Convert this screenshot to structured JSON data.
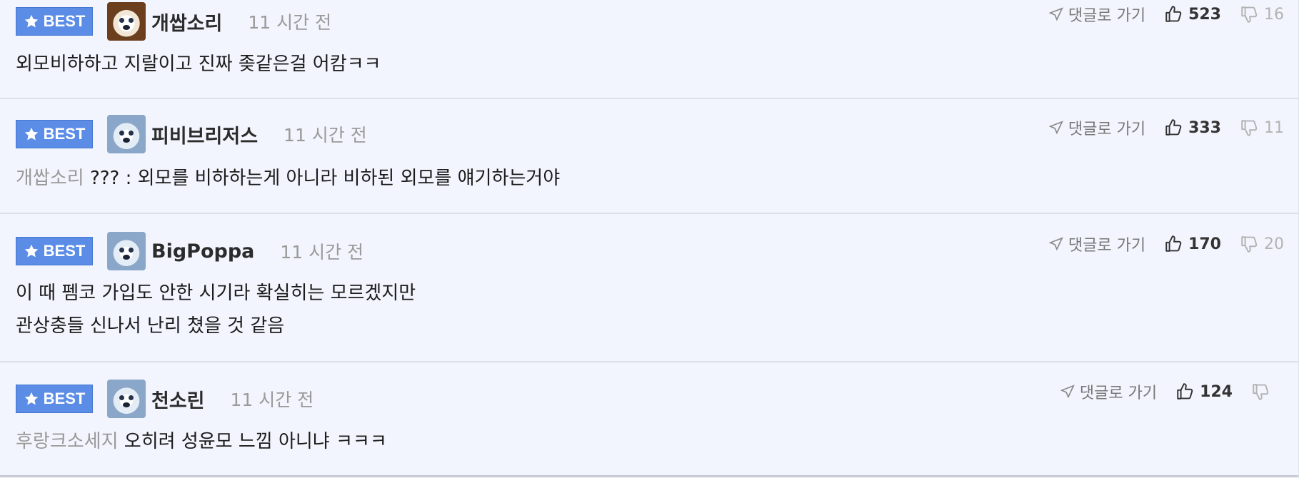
{
  "badge_label": "BEST",
  "goto_label": "댓글로 가기",
  "comments": [
    {
      "nickname": "개쌉소리",
      "time": "11 시간 전",
      "likes": "523",
      "dislikes": "16",
      "mention": "",
      "lines": [
        "외모비하하고 지랄이고 진짜 좆같은걸 어캄ㅋㅋ",
        ""
      ]
    },
    {
      "nickname": "피비브리저스",
      "time": "11 시간 전",
      "likes": "333",
      "dislikes": "11",
      "mention": "개쌉소리",
      "lines": [
        "??? : 외모를 비하하는게 아니라 비하된 외모를 얘기하는거야",
        ""
      ]
    },
    {
      "nickname": "BigPoppa",
      "time": "11 시간 전",
      "likes": "170",
      "dislikes": "20",
      "mention": "",
      "lines": [
        "이 때 펨코 가입도 안한 시기라 확실히는 모르겠지만",
        "관상충들 신나서 난리 쳤을 것 같음"
      ]
    },
    {
      "nickname": "천소린",
      "time": "11 시간 전",
      "likes": "124",
      "dislikes": "",
      "mention": "후랑크소세지",
      "lines": [
        "오히려 성윤모 느낌 아니냐 ㅋㅋㅋ",
        ""
      ]
    }
  ],
  "colors": {
    "badge": "#5b8de6",
    "background": "#f2f5fd",
    "muted": "#999999"
  }
}
